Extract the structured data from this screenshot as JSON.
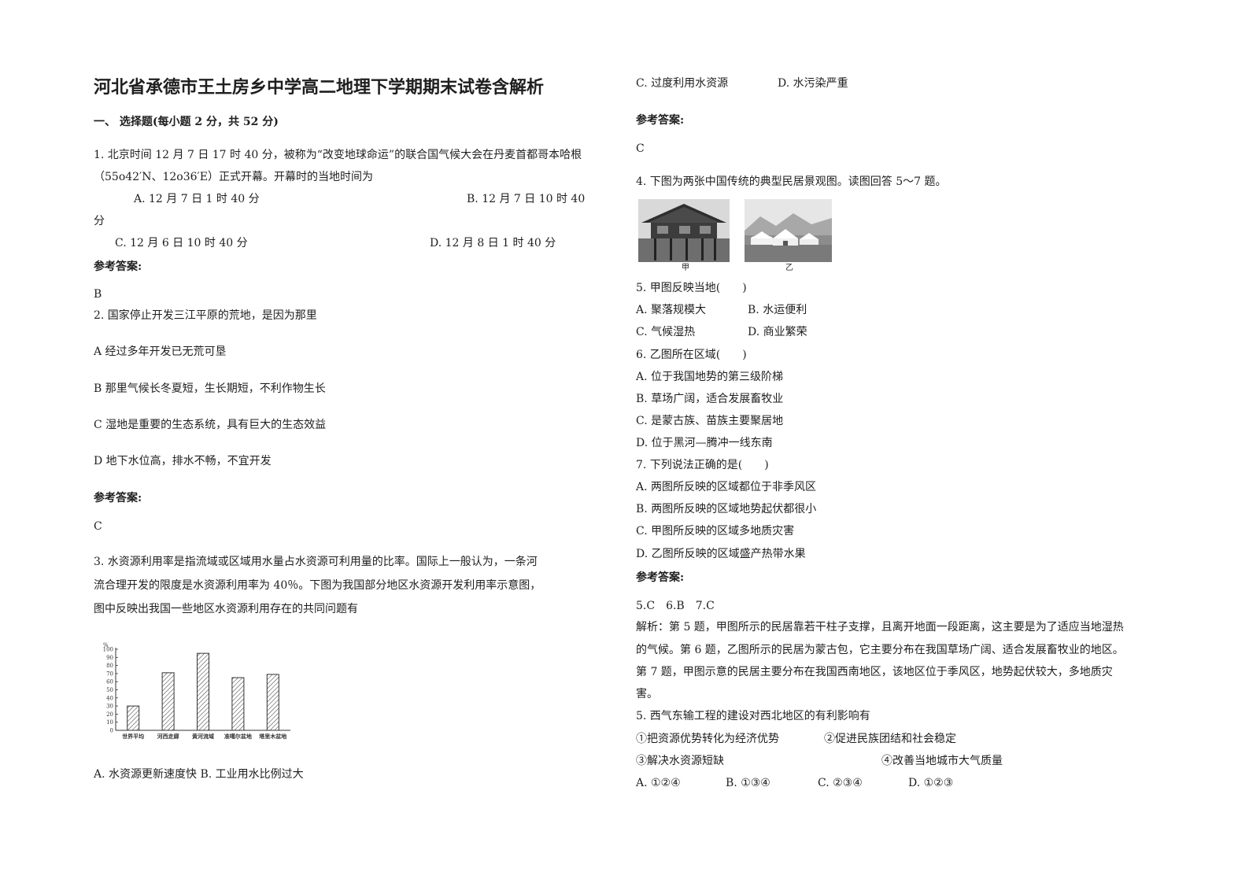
{
  "title": "河北省承德市王土房乡中学高二地理下学期期末试卷含解析",
  "section1": "一、 选择题(每小题 2 分，共 52 分)",
  "answer_label": "参考答案:",
  "q1": {
    "line1": "1. 北京时间 12 月 7 日 17 时 40 分，被称为“改变地球命运”的联合国气候大会在丹麦首都哥本哈根",
    "line2": "（55o42′N、12o36′E）正式开幕。开幕时的当地时间为",
    "opt_a": "A. 12 月 7 日 1 时 40 分",
    "opt_b": "B. 12 月 7 日 10 时 40",
    "opt_b_cont": "分",
    "opt_c": "C. 12 月 6 日 10 时 40 分",
    "opt_d": "D. 12 月 8 日 1 时 40 分",
    "answer": "B"
  },
  "q2": {
    "stem": "2. 国家停止开发三江平原的荒地，是因为那里",
    "opt_a": "A 经过多年开发已无荒可垦",
    "opt_b": "B 那里气候长冬夏短，生长期短，不利作物生长",
    "opt_c": "C 湿地是重要的生态系统，具有巨大的生态效益",
    "opt_d": "D 地下水位高，排水不畅，不宜开发",
    "answer": "C"
  },
  "q3": {
    "line1": "3. 水资源利用率是指流域或区域用水量占水资源可利用量的比率。国际上一般认为，一条河",
    "line2": "流合理开发的限度是水资源利用率为 40％。下图为我国部分地区水资源开发利用率示意图，",
    "line3": "图中反映出我国一些地区水资源利用存在的共同问题有",
    "opt_ab": "A. 水资源更新速度快     B. 工业用水比例过大",
    "opt_c": "C. 过度利用水资源",
    "opt_d": "D. 水污染严重",
    "answer": "C"
  },
  "chart_data": {
    "type": "bar",
    "ylabel": "%",
    "ylim": [
      0,
      100
    ],
    "yticks": [
      "0",
      "10",
      "20",
      "30",
      "40",
      "50",
      "60",
      "70",
      "80",
      "90",
      "100"
    ],
    "categories": [
      "世界平均",
      "河西走廊",
      "黄河流域",
      "准噶尔盆地",
      "塔里木盆地"
    ],
    "values": [
      30,
      71,
      95,
      65,
      69
    ],
    "grid": false,
    "pattern": "diagonal-hatch"
  },
  "q4": {
    "stem": "4. 下图为两张中国传统的典型民居景观图。读图回答 5～7 题。",
    "cap_jia": "甲",
    "cap_yi": "乙",
    "q5": "5. 甲图反映当地(　　)",
    "q5_a": "A. 聚落规模大",
    "q5_b": "B. 水运便利",
    "q5_c": "C. 气候湿热",
    "q5_d": "D. 商业繁荣",
    "q6": "6. 乙图所在区域(　　)",
    "q6_a": "A. 位于我国地势的第三级阶梯",
    "q6_b": "B. 草场广阔，适合发展畜牧业",
    "q6_c": "C. 是蒙古族、苗族主要聚居地",
    "q6_d": "D. 位于黑河—腾冲一线东南",
    "q7": "7. 下列说法正确的是(　　)",
    "q7_a": "A. 两图所反映的区域都位于非季风区",
    "q7_b": "B. 两图所反映的区域地势起伏都很小",
    "q7_c": "C. 甲图所反映的区域多地质灾害",
    "q7_d": "D. 乙图所反映的区域盛产热带水果",
    "answer": "5.C　6.B　7.C",
    "exp1": "解析：第 5 题，甲图所示的民居靠若干柱子支撑，且离开地面一段距离，这主要是为了适应当地湿热",
    "exp2": "的气候。第 6 题，乙图所示的民居为蒙古包，它主要分布在我国草场广阔、适合发展畜牧业的地区。",
    "exp3": "第 7 题，甲图示意的民居主要分布在我国西南地区，该地区位于季风区，地势起伏较大，多地质灾",
    "exp4": "害。"
  },
  "q5x": {
    "stem": "5. 西气东输工程的建设对西北地区的有利影响有",
    "item1": "①把资源优势转化为经济优势",
    "item2": "②促进民族团结和社会稳定",
    "item3": "③解决水资源短缺",
    "item4": "④改善当地城市大气质量",
    "opt_a": "A. ①②④",
    "opt_b": "B. ①③④",
    "opt_c": "C. ②③④",
    "opt_d": "D. ①②③"
  }
}
